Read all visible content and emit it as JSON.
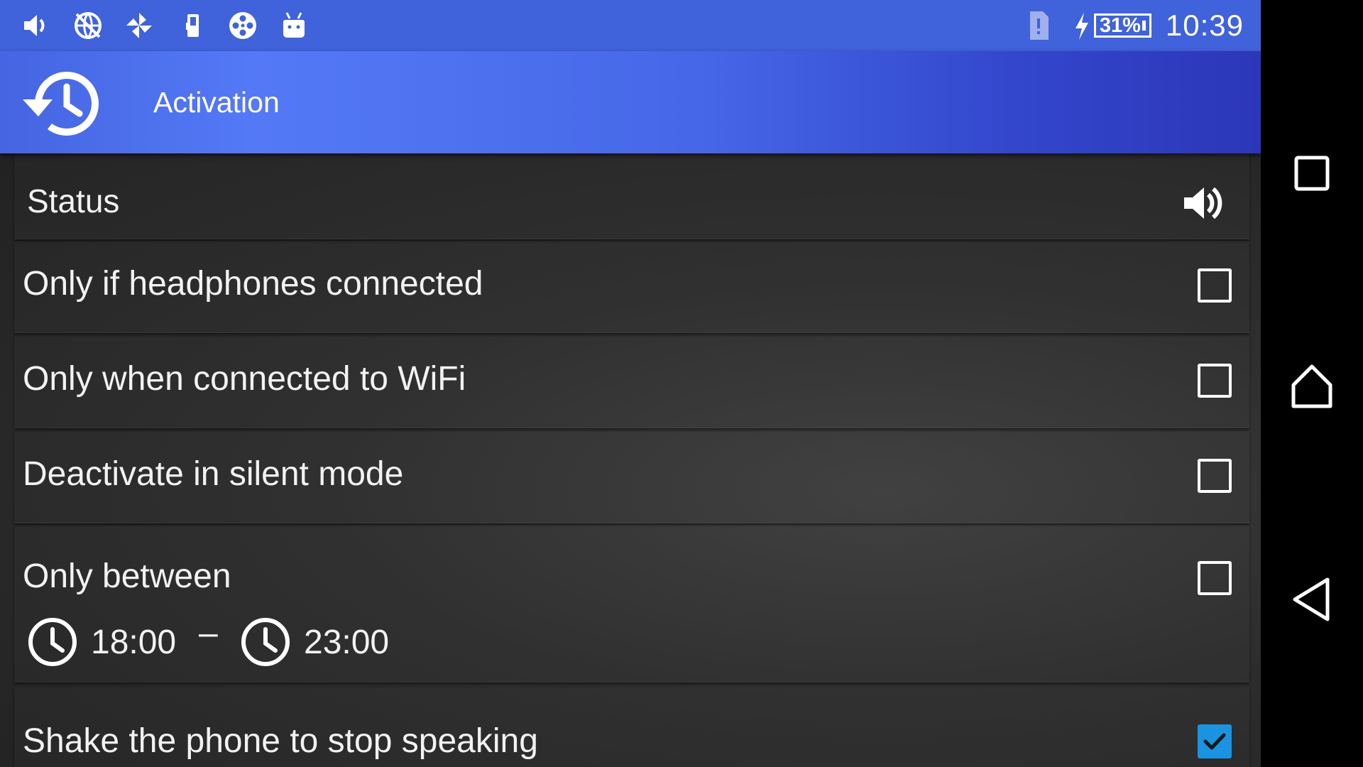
{
  "status_bar": {
    "left_icons": [
      "volume-icon",
      "globe-off-icon",
      "pinwheel-icon",
      "phone-battery-icon",
      "film-reel-icon",
      "android-icon"
    ],
    "right_icons": [
      "sim-alert-icon",
      "charging-bolt-icon"
    ],
    "battery_percent": "31%",
    "time": "10:39"
  },
  "app_bar": {
    "icon": "history-icon",
    "title": "Activation"
  },
  "settings": {
    "status": {
      "label": "Status",
      "icon": "volume-icon"
    },
    "options": [
      {
        "label": "Only if headphones connected",
        "checked": false
      },
      {
        "label": "Only when connected to WiFi",
        "checked": false
      },
      {
        "label": "Deactivate in silent mode",
        "checked": false
      },
      {
        "label": "Only between",
        "checked": false
      },
      {
        "label": "Shake the phone to stop speaking",
        "checked": true
      }
    ],
    "time_range": {
      "start": "18:00",
      "separator": "–",
      "end": "23:00"
    }
  },
  "nav_bar": {
    "buttons": [
      "recents-square-icon",
      "home-icon",
      "back-triangle-icon"
    ]
  },
  "colors": {
    "status_bar": "#4062da",
    "app_bar_accent": "#5479f6",
    "checkbox_checked": "#1a94e0",
    "content_bg": "#2d2d2d"
  }
}
